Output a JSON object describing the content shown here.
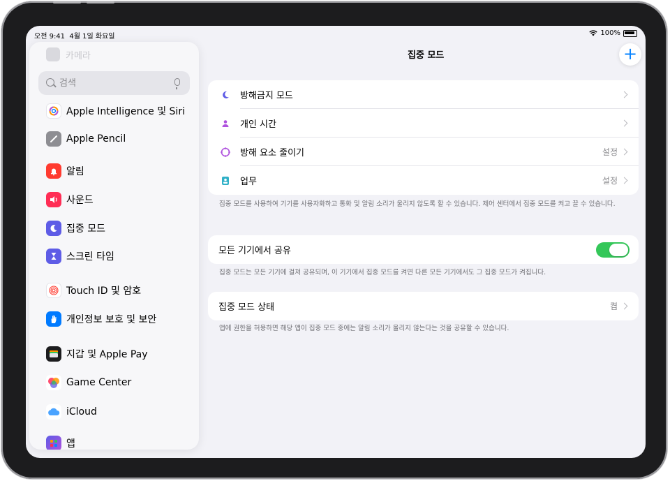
{
  "status_bar": {
    "time": "오전 9:41",
    "date": "4월 1일 화요일",
    "battery": "100%"
  },
  "sidebar": {
    "faded_item": "카메라",
    "search": {
      "placeholder": "검색"
    },
    "items": [
      {
        "label": "Apple Intelligence 및 Siri",
        "icon": "apple-intelligence-icon",
        "color": "#ffffff"
      },
      {
        "label": "Apple Pencil",
        "icon": "pencil-icon",
        "color": "#8e8e93"
      },
      {
        "label": "알림",
        "icon": "bell-icon",
        "color": "#ff3b30"
      },
      {
        "label": "사운드",
        "icon": "speaker-icon",
        "color": "#ff2d55"
      },
      {
        "label": "집중 모드",
        "icon": "moon-icon",
        "color": "#5e5ce6"
      },
      {
        "label": "스크린 타임",
        "icon": "hourglass-icon",
        "color": "#5e5ce6"
      },
      {
        "label": "Touch ID 및 암호",
        "icon": "fingerprint-icon",
        "color": "#ffffff"
      },
      {
        "label": "개인정보 보호 및 보안",
        "icon": "hand-icon",
        "color": "#007aff"
      },
      {
        "label": "지갑 및 Apple Pay",
        "icon": "wallet-icon",
        "color": "#1c1c1e"
      },
      {
        "label": "Game Center",
        "icon": "game-center-icon",
        "color": "#ffffff"
      },
      {
        "label": "iCloud",
        "icon": "cloud-icon",
        "color": "#ffffff"
      },
      {
        "label": "앱",
        "icon": "apps-icon",
        "color": "#5e5ce6"
      }
    ]
  },
  "main": {
    "title": "집중 모드",
    "add_label": "+",
    "focus_modes": [
      {
        "label": "방해금지 모드",
        "value": "",
        "icon": "moon-icon",
        "color": "#5e5ce6"
      },
      {
        "label": "개인 시간",
        "value": "",
        "icon": "person-icon",
        "color": "#af52de"
      },
      {
        "label": "방해 요소 줄이기",
        "value": "설정",
        "icon": "reduce-interruptions-icon",
        "color": "#af52de"
      },
      {
        "label": "업무",
        "value": "설정",
        "icon": "id-badge-icon",
        "color": "#30b0c7"
      }
    ],
    "focus_footnote": "집중 모드를 사용하여 기기를 사용자화하고 통화 및 알림 소리가 울리지 않도록 할 수 있습니다. 제어 센터에서 집중 모드를 켜고 끌 수 있습니다.",
    "share": {
      "label": "모든 기기에서 공유",
      "enabled": true
    },
    "share_footnote": "집중 모드는 모든 기기에 걸쳐 공유되며, 이 기기에서 집중 모드를 켜면 다른 모든 기기에서도 그 집중 모드가 켜집니다.",
    "status": {
      "label": "집중 모드 상태",
      "value": "켬"
    },
    "status_footnote": "앱에 권한을 허용하면 해당 앱이 집중 모드 중에는 알림 소리가 울리지 않는다는 것을 공유할 수 있습니다."
  },
  "colors": {
    "accent": "#0a84ff",
    "toggle_on": "#34c759",
    "background": "#f2f2f7"
  }
}
